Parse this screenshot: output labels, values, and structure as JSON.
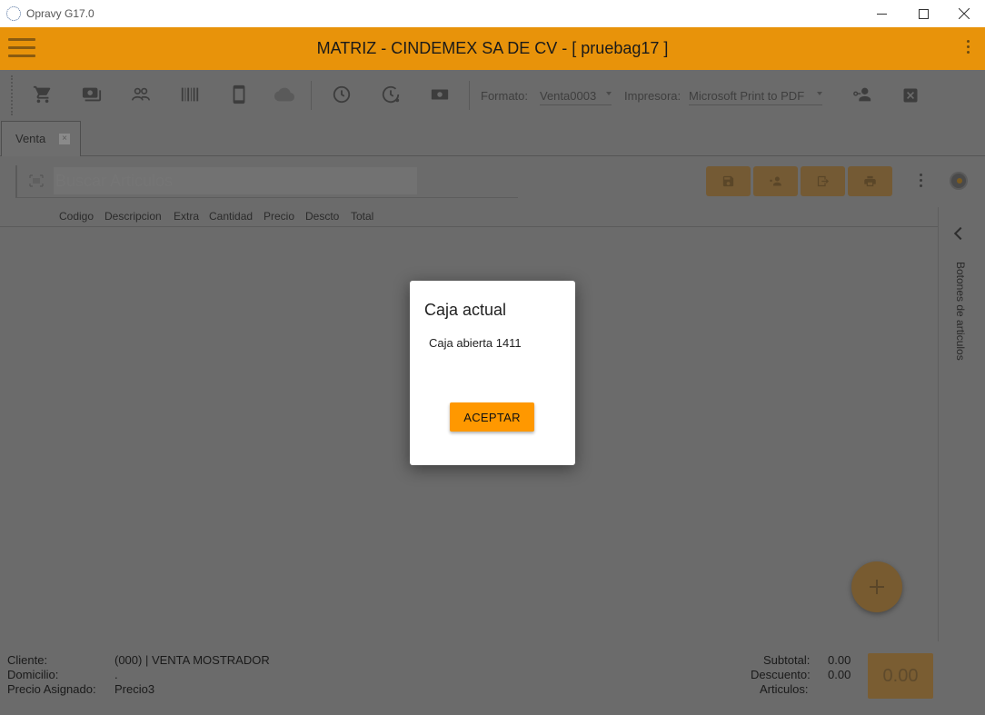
{
  "window": {
    "title": "Opravy G17.0",
    "minimize_icon": "minimize-icon",
    "maximize_icon": "maximize-icon",
    "close_icon": "close-icon"
  },
  "header": {
    "title": "MATRIZ - CINDEMEX SA DE CV - [ pruebag17 ]",
    "accent_color": "#e8930a"
  },
  "toolbar": {
    "icons": [
      "cart-icon",
      "cash-icon",
      "people-icon",
      "barcode-icon",
      "tablet-icon",
      "cloud-sync-icon",
      "clock-icon",
      "clock-history-icon",
      "money-icon"
    ],
    "format_label": "Formato:",
    "format_value": "Venta0003",
    "printer_label": "Impresora:",
    "printer_value": "Microsoft Print to PDF",
    "right_icons": [
      "user-key-icon",
      "close-box-icon"
    ]
  },
  "tabs": [
    {
      "label": "Venta"
    }
  ],
  "search": {
    "placeholder": "Buscar Articulos"
  },
  "columns": [
    "Codigo",
    "Descripcion",
    "Extra",
    "Cantidad",
    "Precio",
    "Descto",
    "Total"
  ],
  "side_panel": {
    "label": "Botones de articulos"
  },
  "footer": {
    "cliente_label": "Cliente:",
    "cliente_value": "(000) | VENTA MOSTRADOR",
    "domicilio_label": "Domicilio:",
    "domicilio_value": ".",
    "precio_label": "Precio Asignado:",
    "precio_value": "Precio3",
    "subtotal_label": "Subtotal:",
    "subtotal_value": "0.00",
    "descuento_label": "Descuento:",
    "descuento_value": "0.00",
    "articulos_label": "Articulos:",
    "total": "0.00"
  },
  "dialog": {
    "title": "Caja actual",
    "message": "Caja abierta 1411",
    "button": "ACEPTAR",
    "button_color": "#ff9800"
  }
}
